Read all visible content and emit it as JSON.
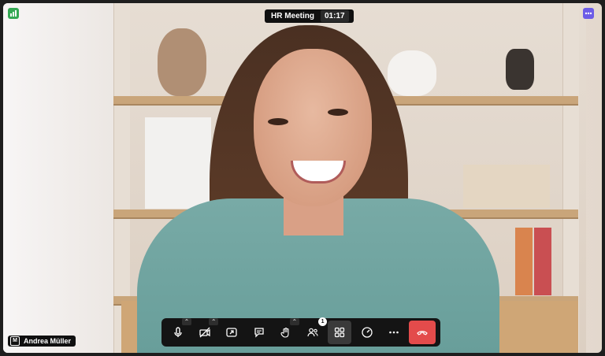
{
  "meeting": {
    "title": "HR Meeting",
    "timer": "01:17"
  },
  "participant": {
    "name": "Andrea Müller",
    "initial": "M"
  },
  "badges": {
    "participant_count": "1"
  },
  "icons": {
    "app": "app-logo-icon",
    "more_menu": "more-options-icon",
    "mic": "microphone-icon",
    "camera": "camera-off-icon",
    "share": "share-screen-icon",
    "chat": "chat-icon",
    "hand": "raise-hand-icon",
    "people": "participants-icon",
    "layout": "grid-layout-icon",
    "stats": "speed-gauge-icon",
    "more": "more-horizontal-icon",
    "leave": "end-call-icon"
  },
  "colors": {
    "leave": "#e34b4b",
    "app_badge": "#34a853",
    "more_badge": "#6c5ce7",
    "toolbar_bg": "#141414"
  }
}
